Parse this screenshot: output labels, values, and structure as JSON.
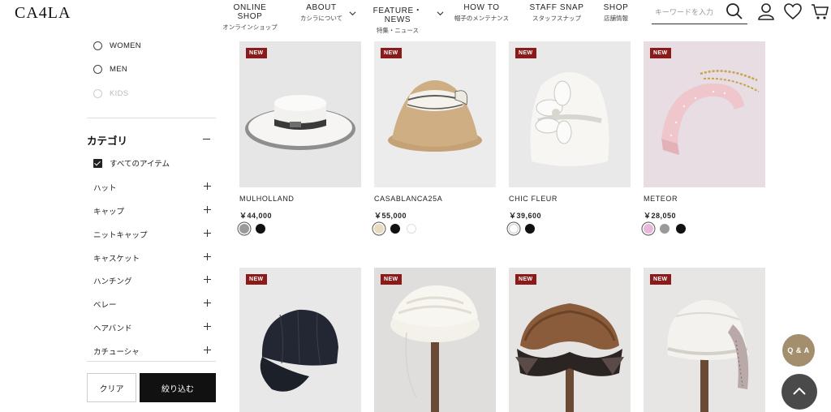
{
  "header": {
    "logo": "CA4LA",
    "nav": [
      {
        "en": "ONLINE SHOP",
        "ja": "オンラインショップ"
      },
      {
        "en": "ABOUT",
        "ja": "カシラについて"
      },
      {
        "en": "FEATURE・NEWS",
        "ja": "特集・ニュース"
      },
      {
        "en": "HOW TO",
        "ja": "帽子のメンテナンス"
      },
      {
        "en": "STAFF SNAP",
        "ja": "スタッフスナップ"
      },
      {
        "en": "SHOP",
        "ja": "店舗情報"
      }
    ],
    "search_placeholder": "キーワードを入力",
    "icons": [
      "search-icon",
      "user-icon",
      "heart-icon",
      "cart-icon"
    ]
  },
  "sidebar": {
    "gender": [
      {
        "label": "WOMEN",
        "disabled": false
      },
      {
        "label": "MEN",
        "disabled": false
      },
      {
        "label": "KIDS",
        "disabled": true
      }
    ],
    "category_title": "カテゴリ",
    "all_items_label": "すべてのアイテム",
    "categories": [
      "ハット",
      "キャップ",
      "ニットキャップ",
      "キャスケット",
      "ハンチング",
      "ベレー",
      "ヘアバンド",
      "カチューシャ"
    ],
    "clear_label": "クリア",
    "apply_label": "絞り込む"
  },
  "products": [
    {
      "badge": "NEW",
      "name": "MULHOLLAND",
      "price": "￥44,000",
      "swatches": [
        "#9a9a9a",
        "#111111"
      ],
      "selected": 0
    },
    {
      "badge": "NEW",
      "name": "CASABLANCA25A",
      "price": "￥55,000",
      "swatches": [
        "#e8dcc0",
        "#111111",
        "#ffffff"
      ],
      "selected": 0
    },
    {
      "badge": "NEW",
      "name": "CHIC FLEUR",
      "price": "￥39,600",
      "swatches": [
        "#ffffff",
        "#111111"
      ],
      "selected": 0
    },
    {
      "badge": "NEW",
      "name": "METEOR",
      "price": "￥28,050",
      "swatches": [
        "#e9b8d8",
        "#9a9a9a",
        "#111111"
      ],
      "selected": 0
    },
    {
      "badge": "NEW"
    },
    {
      "badge": "NEW"
    },
    {
      "badge": "NEW"
    },
    {
      "badge": "NEW"
    }
  ],
  "floating": {
    "qa_label": "Q & A",
    "top_icon": "chevron-up-icon"
  },
  "colors": {
    "badge": "#8b1a1a",
    "qa_button": "#a38e6e",
    "top_button": "#4a4a4a"
  }
}
